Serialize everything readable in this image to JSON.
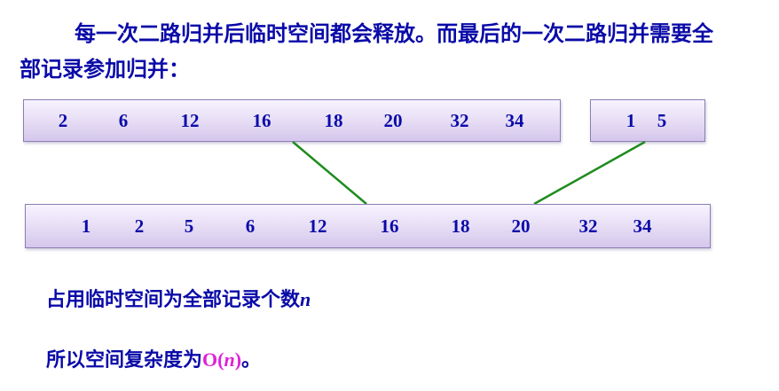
{
  "intro": {
    "line1": "每一次二路归并后临时空间都会释放。而最后的一次二路归并需要全部记录参加归并："
  },
  "left_run": [
    "2",
    "6",
    "12",
    "16",
    "18",
    "20",
    "32",
    "34"
  ],
  "right_run": [
    "1",
    "5"
  ],
  "merged_run": [
    "1",
    "2",
    "5",
    "6",
    "12",
    "16",
    "18",
    "20",
    "32",
    "34"
  ],
  "note1": {
    "text": "占用临时空间为全部记录个数",
    "var": "n"
  },
  "note2": {
    "text": "所以空间复杂度为",
    "o_open": "O(",
    "var": "n",
    "o_close": ")",
    "period": "。"
  },
  "colors": {
    "text": "#0a0aa8",
    "connector": "#1e8c1e",
    "highlight": "#e020d8"
  }
}
